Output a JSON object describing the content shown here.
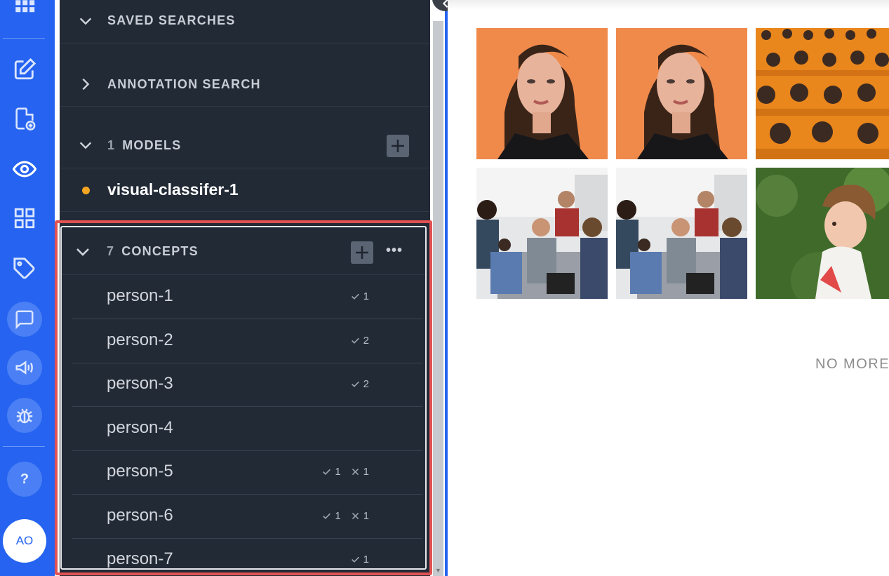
{
  "rail": {
    "icons": [
      "apps-grid-icon",
      "edit-icon",
      "new-file-icon",
      "eye-icon",
      "dashboard-grid-icon",
      "tag-icon",
      "chat-icon",
      "megaphone-icon",
      "bug-icon"
    ],
    "help_label": "?",
    "avatar_initials": "AO",
    "accent_color": "#2563f0"
  },
  "sidebar": {
    "saved_searches": {
      "title": "SAVED SEARCHES"
    },
    "annotation_search": {
      "title": "ANNOTATION SEARCH"
    },
    "models": {
      "count": "1",
      "title": "MODELS",
      "items": [
        {
          "name": "visual-classifer-1",
          "status_color": "#f5a623"
        }
      ]
    },
    "concepts": {
      "count": "7",
      "title": "CONCEPTS",
      "more_label": "•••",
      "items": [
        {
          "name": "person-1",
          "positive": "1",
          "negative": ""
        },
        {
          "name": "person-2",
          "positive": "2",
          "negative": ""
        },
        {
          "name": "person-3",
          "positive": "2",
          "negative": ""
        },
        {
          "name": "person-4",
          "positive": "",
          "negative": ""
        },
        {
          "name": "person-5",
          "positive": "1",
          "negative": "1"
        },
        {
          "name": "person-6",
          "positive": "1",
          "negative": "1"
        },
        {
          "name": "person-7",
          "positive": "1",
          "negative": ""
        }
      ]
    }
  },
  "main": {
    "images": [
      {
        "subject": "woman-portrait-orange-background"
      },
      {
        "subject": "woman-portrait-orange-background"
      },
      {
        "subject": "monks-in-orange-robes-crowd"
      },
      {
        "subject": "office-meeting-group"
      },
      {
        "subject": "office-meeting-group"
      },
      {
        "subject": "toddler-eating-watermelon"
      }
    ],
    "end_message": "NO MORE"
  }
}
